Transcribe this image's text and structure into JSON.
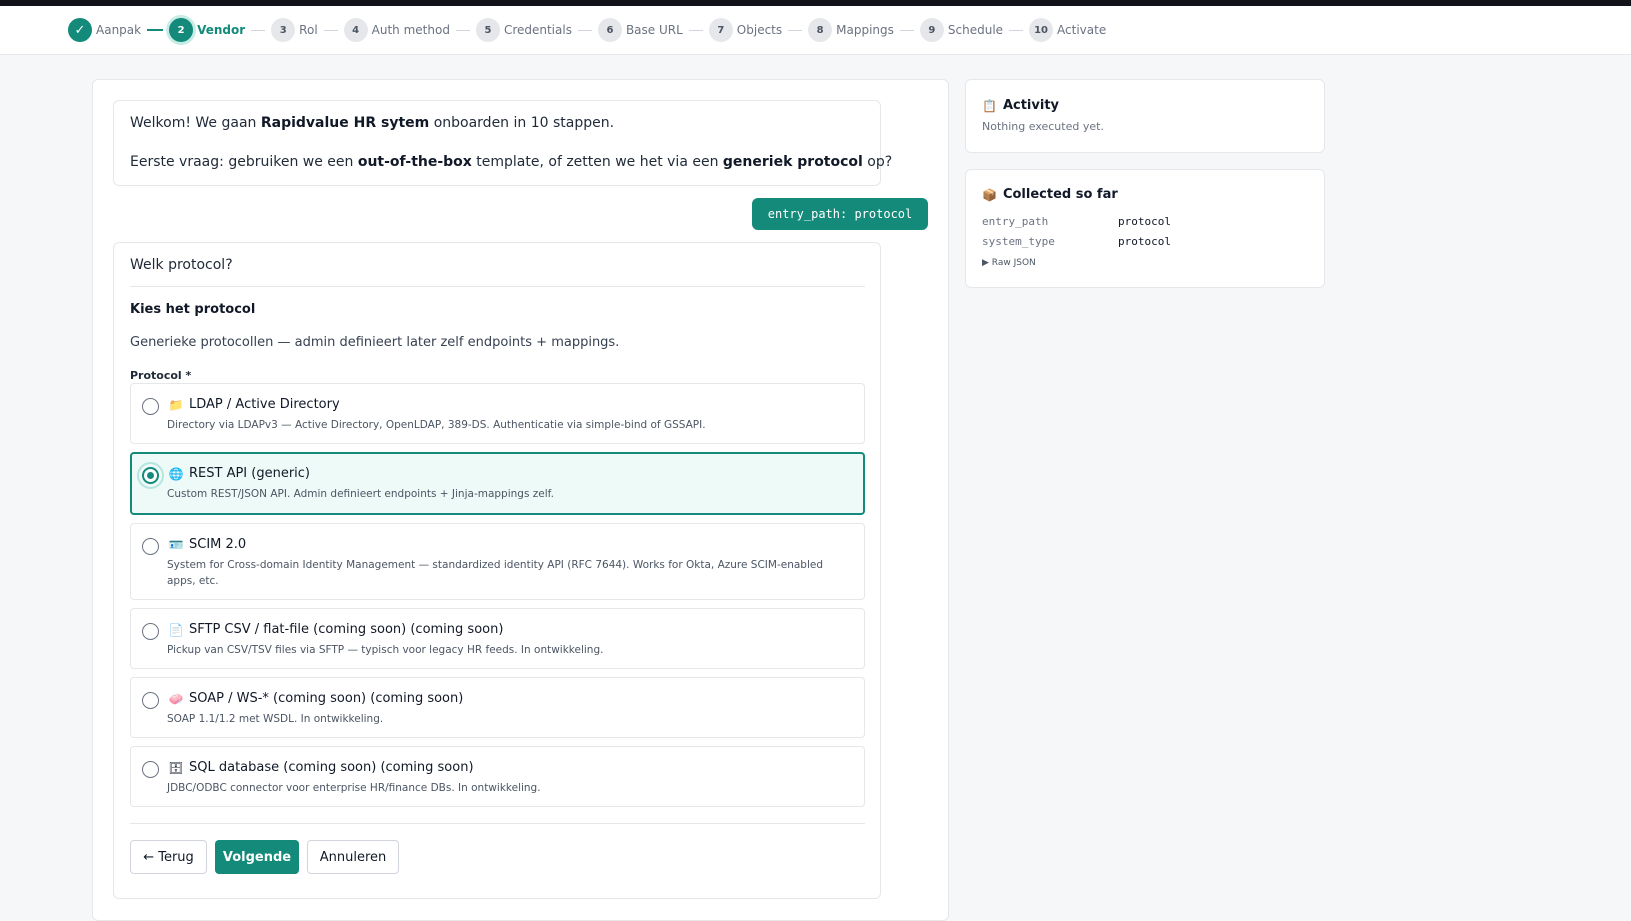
{
  "stepper": {
    "steps": [
      {
        "num": "✓",
        "label": "Aanpak",
        "state": "done"
      },
      {
        "num": "2",
        "label": "Vendor",
        "state": "active"
      },
      {
        "num": "3",
        "label": "Rol",
        "state": "todo"
      },
      {
        "num": "4",
        "label": "Auth method",
        "state": "todo"
      },
      {
        "num": "5",
        "label": "Credentials",
        "state": "todo"
      },
      {
        "num": "6",
        "label": "Base URL",
        "state": "todo"
      },
      {
        "num": "7",
        "label": "Objects",
        "state": "todo"
      },
      {
        "num": "8",
        "label": "Mappings",
        "state": "todo"
      },
      {
        "num": "9",
        "label": "Schedule",
        "state": "todo"
      },
      {
        "num": "10",
        "label": "Activate",
        "state": "todo"
      }
    ]
  },
  "welcome": {
    "line1_pre": "Welkom! We gaan ",
    "line1_bold": "Rapidvalue HR sytem",
    "line1_post": " onboarden in 10 stappen.",
    "line2_pre": "Eerste vraag: gebruiken we een ",
    "line2_bold1": "out-of-the-box",
    "line2_mid": " template, of zetten we het via een ",
    "line2_bold2": "generiek protocol",
    "line2_post": " op?"
  },
  "entry_pill": "entry_path: protocol",
  "form": {
    "question": "Welk protocol?",
    "section_title": "Kies het protocol",
    "section_desc": "Generieke protocollen — admin definieert later zelf endpoints + mappings.",
    "field_label": "Protocol *",
    "options": [
      {
        "icon": "📁",
        "icon_name": "folder-icon",
        "title": "LDAP / Active Directory",
        "desc": "Directory via LDAPv3 — Active Directory, OpenLDAP, 389-DS. Authenticatie via simple-bind of GSSAPI.",
        "selected": false
      },
      {
        "icon": "🌐",
        "icon_name": "globe-icon",
        "title": "REST API (generic)",
        "desc": "Custom REST/JSON API. Admin definieert endpoints + Jinja-mappings zelf.",
        "selected": true
      },
      {
        "icon": "🪪",
        "icon_name": "id-card-icon",
        "title": "SCIM 2.0",
        "desc": "System for Cross-domain Identity Management — standardized identity API (RFC 7644). Works for Okta, Azure SCIM-enabled apps, etc.",
        "selected": false
      },
      {
        "icon": "📄",
        "icon_name": "document-icon",
        "title": "SFTP CSV / flat-file (coming soon) (coming soon)",
        "desc": "Pickup van CSV/TSV files via SFTP — typisch voor legacy HR feeds. In ontwikkeling.",
        "selected": false
      },
      {
        "icon": "🧼",
        "icon_name": "soap-icon",
        "title": "SOAP / WS-* (coming soon) (coming soon)",
        "desc": "SOAP 1.1/1.2 met WSDL. In ontwikkeling.",
        "selected": false
      },
      {
        "icon": "🗄",
        "icon_name": "database-icon",
        "title": "SQL database (coming soon) (coming soon)",
        "desc": "JDBC/ODBC connector voor enterprise HR/finance DBs. In ontwikkeling.",
        "selected": false
      }
    ],
    "back_label": "← Terug",
    "next_label": "Volgende",
    "cancel_label": "Annuleren"
  },
  "activity": {
    "icon": "📋",
    "title": "Activity",
    "subtitle": "Nothing executed yet."
  },
  "collected": {
    "icon": "📦",
    "title": "Collected so far",
    "rows": [
      {
        "key": "entry_path",
        "value": "protocol"
      },
      {
        "key": "system_type",
        "value": "protocol"
      }
    ],
    "raw_label": "▶ Raw JSON"
  },
  "colors": {
    "accent": "#138a7a",
    "accent_light": "#eefaf8"
  }
}
